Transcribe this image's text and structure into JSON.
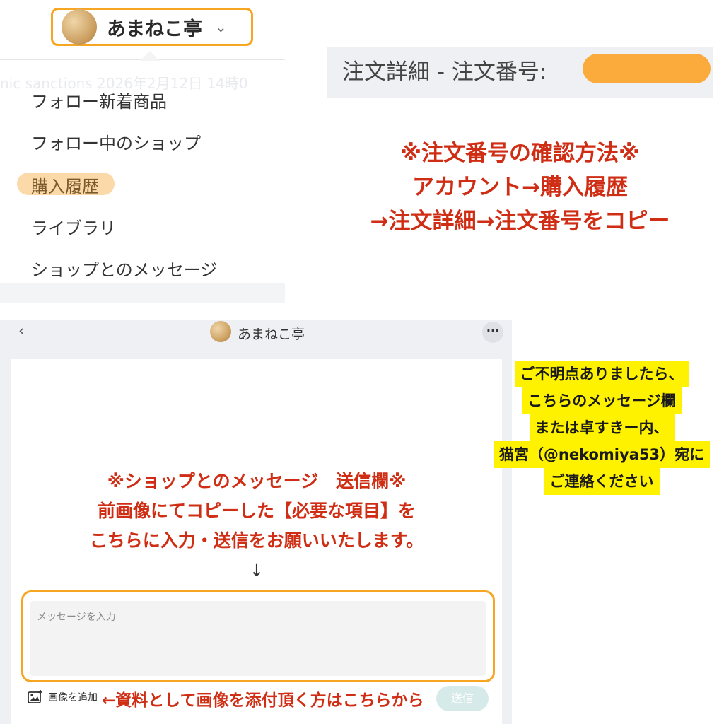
{
  "shop": {
    "name": "あまねこ亭",
    "chevron": "⌄"
  },
  "menu": {
    "ghost_text": "nic sanctions    2026年2月12日 14時0",
    "items": [
      {
        "label": "フォロー新着商品"
      },
      {
        "label": "フォロー中のショップ"
      },
      {
        "label": "購入履歴",
        "highlighted": true
      },
      {
        "label": "ライブラリ"
      },
      {
        "label": "ショップとのメッセージ"
      }
    ]
  },
  "order": {
    "title": "注文詳細 - 注文番号:"
  },
  "how_to": {
    "line1": "※注文番号の確認方法※",
    "line2": "アカウント→購入履歴",
    "line3": "→注文詳細→注文番号をコピー"
  },
  "chat": {
    "back": "‹",
    "title": "あまねこ亭",
    "more": "···",
    "note_line1": "※ショップとのメッセージ　送信欄※",
    "note_line2": "前画像にてコピーした【必要な項目】を",
    "note_line3": "こちらに入力・送信をお願いいたします。",
    "note_arrow": "↓",
    "placeholder": "メッセージを入力",
    "add_image": "画像を追加",
    "send": "送信",
    "attach_note": "←資料として画像を添付頂く方はこちらから"
  },
  "contact": {
    "line1": "ご不明点ありましたら、",
    "line2": "こちらのメッセージ欄",
    "line3": "または卓すきー内、",
    "line4": "猫宮（@nekomiya53）宛に",
    "line5": "ご連絡ください"
  },
  "colors": {
    "accent_orange": "#f6a623",
    "red_text": "#cf2d14",
    "yellow_highlight": "#fff200"
  }
}
